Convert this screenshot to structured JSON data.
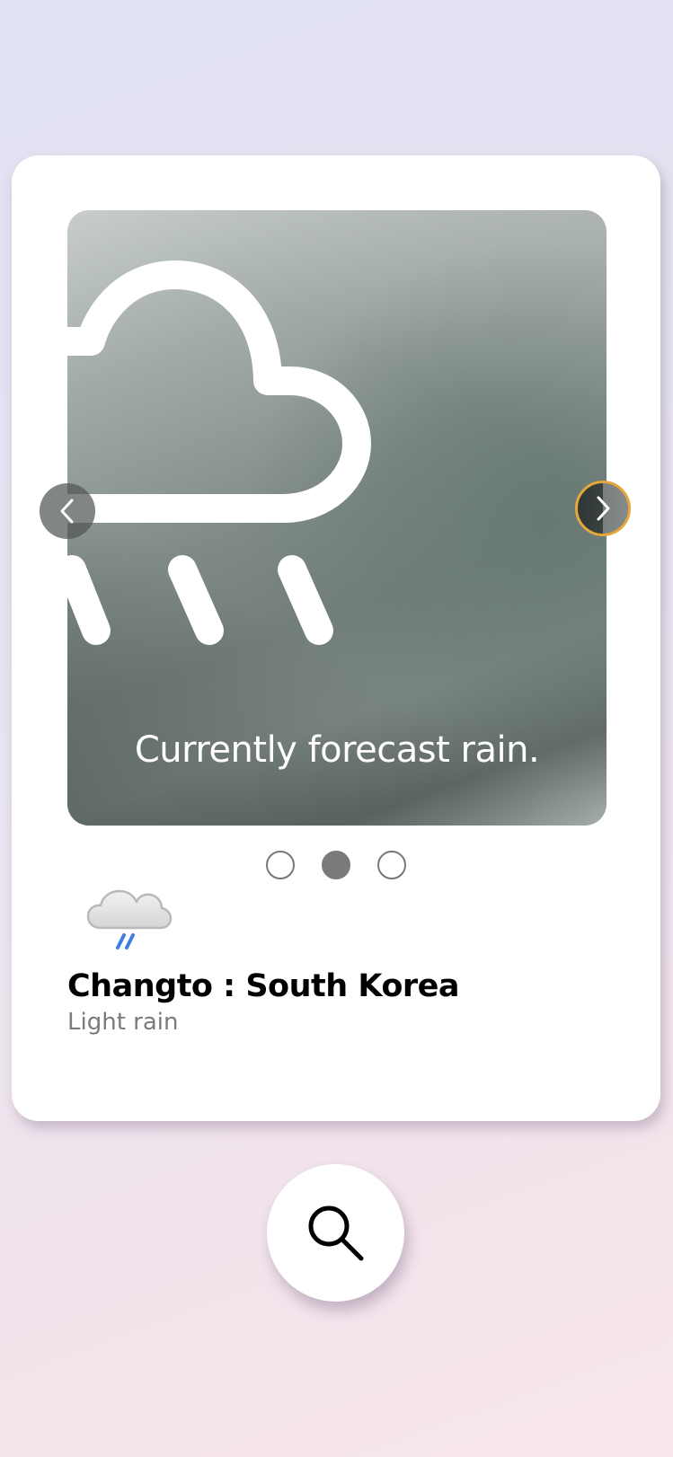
{
  "slide": {
    "caption": "Currently forecast rain.",
    "background_icon": "rain-cloud-icon"
  },
  "carousel": {
    "prev_icon": "chevron-left-icon",
    "next_icon": "chevron-right-icon",
    "total_slides": 3,
    "active_index": 1
  },
  "weather": {
    "icon": "light-rain-icon",
    "location": "Changto : South Korea",
    "condition": "Light rain"
  },
  "search": {
    "icon": "search-icon"
  },
  "colors": {
    "next_button_border": "#e5a63a",
    "active_dot": "#7a7a7a",
    "rain_drops": "#3f7fe0",
    "condition_text": "#7a7a7a"
  }
}
